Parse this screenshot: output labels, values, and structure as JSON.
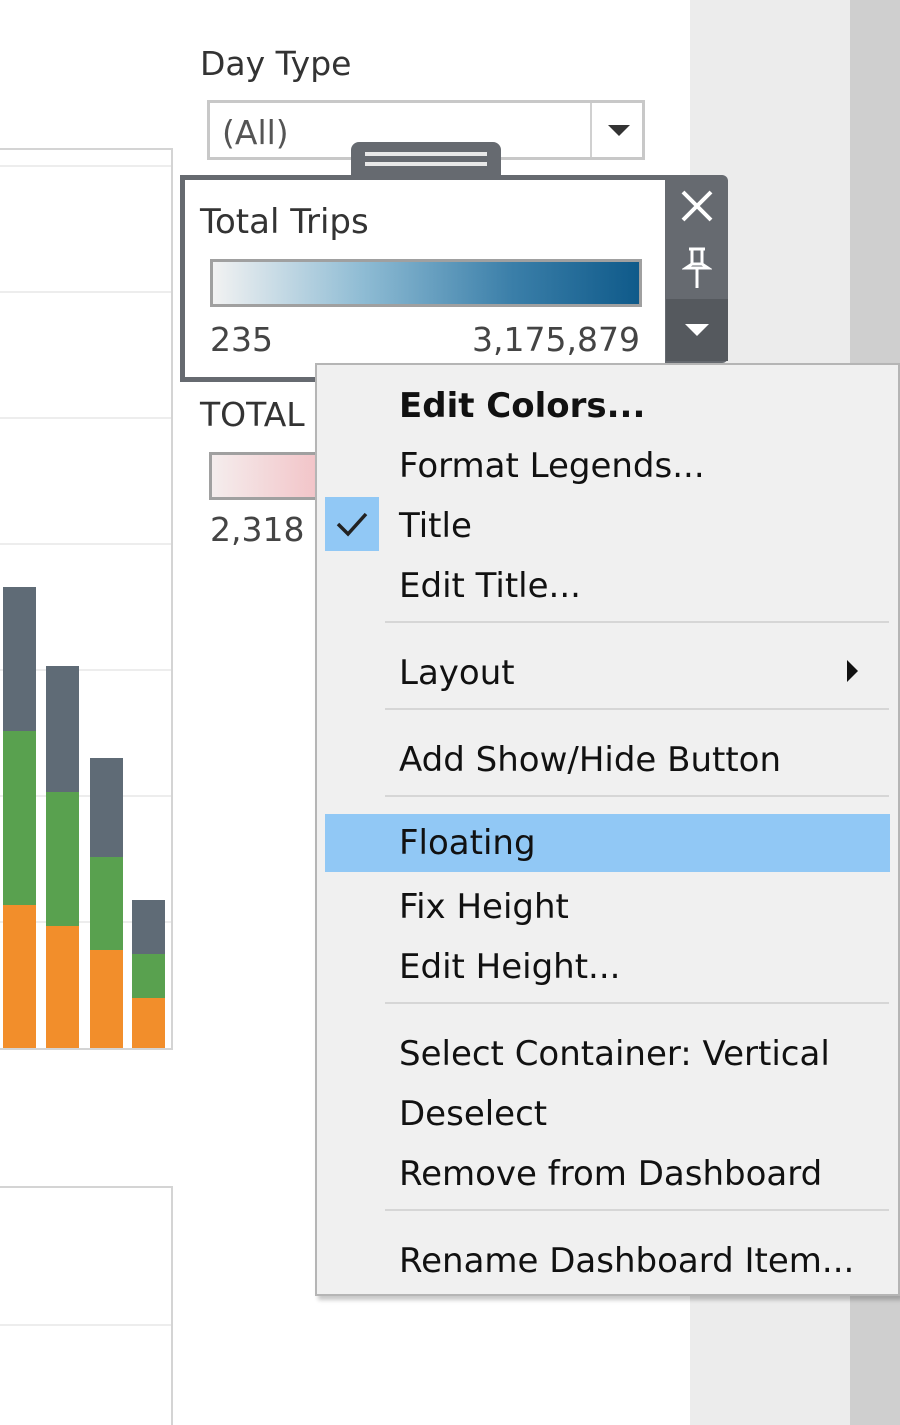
{
  "filter": {
    "title": "Day Type",
    "selected_value": "(All)"
  },
  "legend_selected": {
    "title": "Total Trips",
    "min_label": "235",
    "max_label": "3,175,879",
    "colors": {
      "start": "#f2f2f2",
      "end": "#0f5a8a"
    }
  },
  "legend_tools": {
    "close_icon": "close-icon",
    "pin_icon": "pin-icon",
    "menu_icon": "dropdown-arrow-icon"
  },
  "legend_secondary": {
    "title": "TOTAL",
    "min_label": "2,318"
  },
  "chart_data": {
    "type": "bar",
    "stacked": true,
    "series": [
      {
        "name": "",
        "color": "#f28e2b",
        "values": [
          143,
          122,
          98,
          50
        ]
      },
      {
        "name": "",
        "color": "#59a14f",
        "values": [
          174,
          134,
          93,
          44
        ]
      },
      {
        "name": "",
        "color": "#5f6b76",
        "values": [
          144,
          126,
          99,
          54
        ]
      }
    ],
    "ylim": [
      0,
      461
    ]
  },
  "context_menu": {
    "items": [
      {
        "label": "Edit Colors...",
        "bold": true
      },
      {
        "label": "Format Legends..."
      },
      {
        "label": "Title",
        "checked": true
      },
      {
        "label": "Edit Title..."
      },
      {
        "label": "Layout",
        "submenu": true
      },
      {
        "label": "Add Show/Hide Button"
      },
      {
        "label": "Floating",
        "highlighted": true
      },
      {
        "label": "Fix Height"
      },
      {
        "label": "Edit Height..."
      },
      {
        "label": "Select Container: Vertical"
      },
      {
        "label": "Deselect"
      },
      {
        "label": "Remove from Dashboard"
      },
      {
        "label": "Rename Dashboard Item..."
      }
    ],
    "highlight_color": "#91c8f5"
  }
}
